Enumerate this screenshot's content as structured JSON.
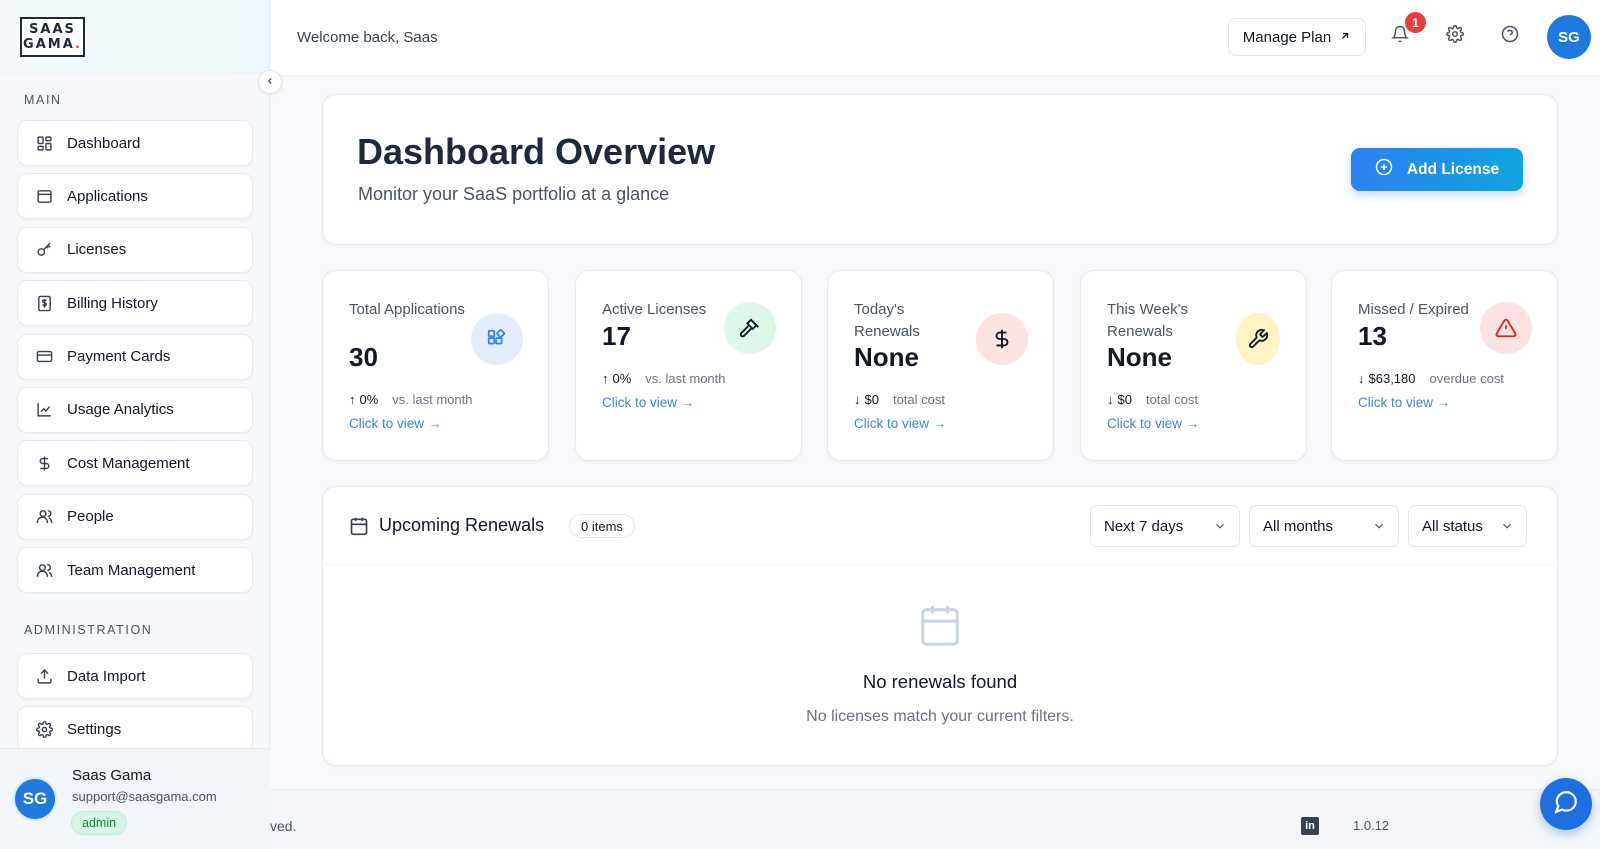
{
  "brand": {
    "logo_line1": "SAAS",
    "logo_line2": "GAMA",
    "logo_dot": "."
  },
  "sidebar": {
    "main_title": "MAIN",
    "main_items": [
      {
        "label": "Dashboard",
        "icon": "grid-icon"
      },
      {
        "label": "Applications",
        "icon": "window-icon"
      },
      {
        "label": "Licenses",
        "icon": "key-icon"
      },
      {
        "label": "Billing History",
        "icon": "receipt-icon"
      },
      {
        "label": "Payment Cards",
        "icon": "credit-card-icon"
      },
      {
        "label": "Usage Analytics",
        "icon": "line-chart-icon"
      },
      {
        "label": "Cost Management",
        "icon": "dollar-icon"
      },
      {
        "label": "People",
        "icon": "user-icon"
      },
      {
        "label": "Team Management",
        "icon": "users-icon"
      }
    ],
    "admin_title": "ADMINISTRATION",
    "admin_items": [
      {
        "label": "Data Import",
        "icon": "upload-icon"
      },
      {
        "label": "Settings",
        "icon": "gear-icon"
      }
    ],
    "user": {
      "initials": "SG",
      "name": "Saas Gama",
      "email": "support@saasgama.com",
      "role": "admin"
    }
  },
  "header": {
    "welcome": "Welcome back, Saas",
    "manage_plan": "Manage Plan",
    "notification_count": "1",
    "avatar_initials": "SG"
  },
  "overview": {
    "title": "Dashboard Overview",
    "subtitle": "Monitor your SaaS portfolio at a glance",
    "add_button": "Add License"
  },
  "stats": [
    {
      "label": "Total Applications",
      "value": "30",
      "delta_arrow": "↑",
      "delta": "0%",
      "delta_note": "vs. last month",
      "link": "Click to view →",
      "icon": "apps-icon",
      "accent": "#3b82f6",
      "bg": "#e3edfc"
    },
    {
      "label": "Active Licenses",
      "value": "17",
      "delta_arrow": "↑",
      "delta": "0%",
      "delta_note": "vs. last month",
      "link": "Click to view →",
      "icon": "gavel-icon",
      "accent": "#111827",
      "bg": "#ddf7e8"
    },
    {
      "label": "Today's Renewals",
      "value": "None",
      "delta_arrow": "↓",
      "delta": "$0",
      "delta_note": "total cost",
      "link": "Click to view →",
      "icon": "dollar-icon",
      "accent": "#111827",
      "bg": "#fde2e2"
    },
    {
      "label": "This Week's Renewals",
      "value": "None",
      "delta_arrow": "↓",
      "delta": "$0",
      "delta_note": "total cost",
      "link": "Click to view →",
      "icon": "wrench-icon",
      "accent": "#111827",
      "bg": "#fdf3c4"
    },
    {
      "label": "Missed / Expired",
      "value": "13",
      "delta_arrow": "↓",
      "delta": "$63,180",
      "delta_note": "overdue cost",
      "link": "Click to view →",
      "icon": "warning-icon",
      "accent": "#dc2626",
      "bg": "#fde2e2"
    }
  ],
  "renewals": {
    "title": "Upcoming Renewals",
    "count": "0 items",
    "filters": [
      "Next 7 days",
      "All months",
      "All status"
    ],
    "empty_title": "No renewals found",
    "empty_sub": "No licenses match your current filters."
  },
  "footer": {
    "left_text": "ved.",
    "linkedin": "in",
    "version": "1.0.12"
  }
}
